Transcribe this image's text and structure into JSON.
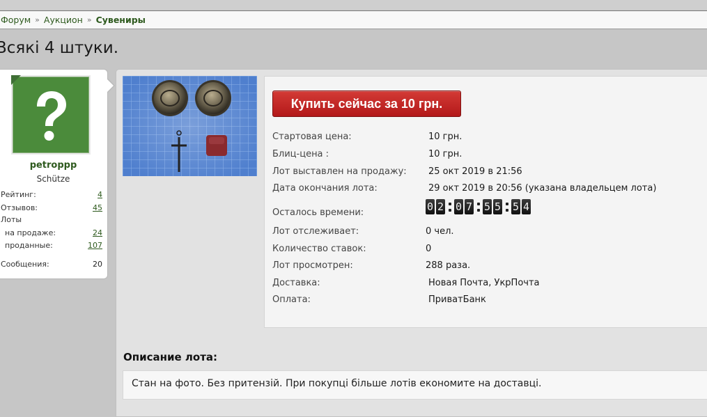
{
  "breadcrumb": {
    "items": [
      "Форум",
      "Аукцион"
    ],
    "current": "Сувениры",
    "separator": "»"
  },
  "lot": {
    "title": "Всякі 4 штуки."
  },
  "user": {
    "name": "petroppp",
    "rank": "Schütze",
    "stats": {
      "rating_label": "Рейтинг:",
      "rating": "4",
      "reviews_label": "Отзывов:",
      "reviews": "45",
      "lots_label": "Лоты",
      "on_sale_label": "на продаже:",
      "on_sale": "24",
      "sold_label": "проданные:",
      "sold": "107",
      "messages_label": "Сообщения:",
      "messages": "20"
    }
  },
  "auction": {
    "buy_button": "Купить сейчас за 10 грн.",
    "rows": {
      "start_price_label": "Стартовая цена:",
      "start_price": "10 грн.",
      "blitz_label": "Блиц-цена :",
      "blitz": "10 грн.",
      "listed_label": "Лот выставлен на продажу:",
      "listed": "25 окт 2019 в 21:56",
      "end_label": "Дата окончания лота:",
      "end": "29 окт 2019 в 20:56 (указана владельцем лота)",
      "remaining_label": "Осталось времени:",
      "watchers_label": "Лот отслеживает:",
      "watchers": "0 чел.",
      "bids_label": "Количество ставок:",
      "bids": "0",
      "views_label": "Лот просмотрен:",
      "views": "288 раза.",
      "delivery_label": "Доставка:",
      "delivery": "Новая Почта, УкрПочта",
      "payment_label": "Оплата:",
      "payment": "ПриватБанк"
    },
    "timer": {
      "d1": "0",
      "d2": "2",
      "h1": "0",
      "h2": "7",
      "m1": "5",
      "m2": "5",
      "s1": "5",
      "s2": "4"
    }
  },
  "description": {
    "heading": "Описание лота:",
    "text": "Стан на фото. Без притензій. При покупці більше лотів економите на доставці."
  },
  "colors": {
    "link_green": "#2e5a1e",
    "buy_red": "#c42a27",
    "avatar_green": "#4b8b3b"
  },
  "icons": [
    "question-mark-icon",
    "chevron-separator-icon"
  ]
}
